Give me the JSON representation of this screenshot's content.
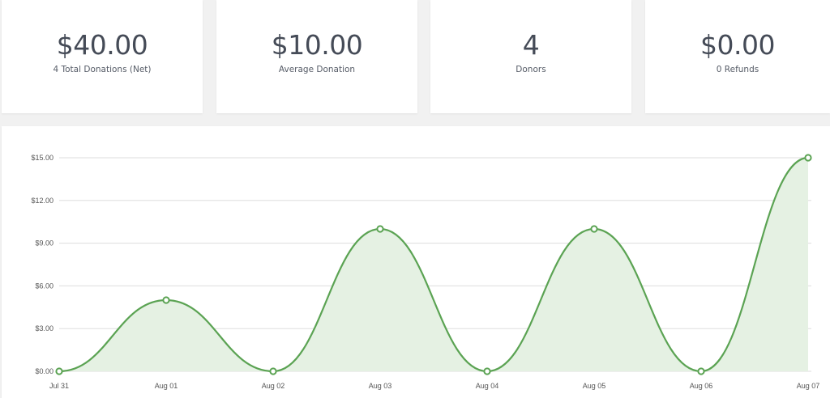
{
  "stats": [
    {
      "value": "$40.00",
      "label": "4 Total Donations (Net)"
    },
    {
      "value": "$10.00",
      "label": "Average Donation"
    },
    {
      "value": "4",
      "label": "Donors"
    },
    {
      "value": "$0.00",
      "label": "0 Refunds"
    }
  ],
  "chart_data": {
    "type": "area",
    "categories": [
      "Jul 31",
      "Aug 01",
      "Aug 02",
      "Aug 03",
      "Aug 04",
      "Aug 05",
      "Aug 06",
      "Aug 07"
    ],
    "series": [
      {
        "values": [
          0,
          5,
          0,
          10,
          0,
          10,
          0,
          15
        ]
      }
    ],
    "y_ticks": [
      "$0.00",
      "$3.00",
      "$6.00",
      "$9.00",
      "$12.00",
      "$15.00"
    ],
    "ylim": [
      0,
      15
    ],
    "grid": true,
    "legend": "none",
    "colors": {
      "line": "#5ba353",
      "fill": "#e5f1e3",
      "grid": "#dddddd"
    }
  }
}
